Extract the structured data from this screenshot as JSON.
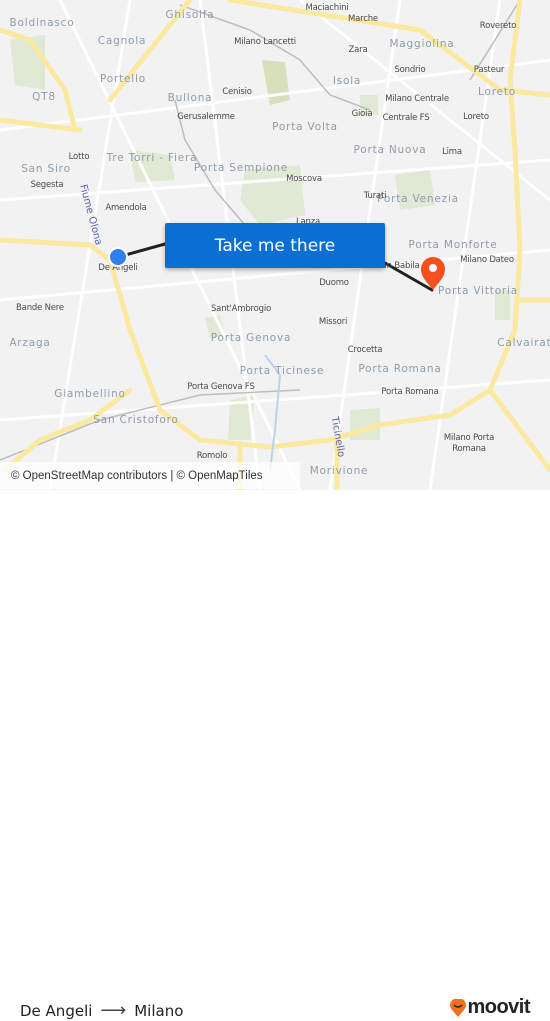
{
  "map": {
    "districts": [
      "Boldinasco",
      "Cagnola",
      "Ghisolfa",
      "Portello",
      "QT8",
      "Bullona",
      "Maggiolina",
      "Isola",
      "Porta Volta",
      "Porta Nuova",
      "Loreto",
      "Tre Torri - Fiera",
      "San Siro",
      "Porta Sempione",
      "Porta Venezia",
      "Porta Monforte",
      "Porta Vittoria",
      "Arzaga",
      "Porta Genova",
      "Calvairate",
      "Porta Ticinese",
      "Porta Romana",
      "Giambellino",
      "San Cristoforo",
      "Morivione"
    ],
    "stations": [
      "Maciachini",
      "Marche",
      "Milano Lancetti",
      "Zara",
      "Sondrio",
      "Rovereto",
      "Pasteur",
      "Cenisio",
      "Milano Centrale",
      "Gioia",
      "Centrale FS",
      "Loreto",
      "Gerusalemme",
      "Lima",
      "Lotto",
      "Segesta",
      "Moscova",
      "Turati",
      "Amendola",
      "Bande Nere",
      "Sant'Ambrogio",
      "Duomo",
      "Missori",
      "Crocetta",
      "Porta Genova FS",
      "Porta Romana",
      "Milano Dateo",
      "Milano Porta",
      "Romana",
      "Romolo",
      "De Angeli",
      "San Babila",
      "Lanza"
    ],
    "waterways": [
      "Fiume Olona",
      "Ticinello"
    ],
    "origin_color": "#2f7ff0",
    "destination_color": "#f4511e",
    "attribution": "© OpenStreetMap contributors | © OpenMapTiles"
  },
  "cta": {
    "label": "Take me there",
    "color": "#0a6fd3"
  },
  "footer": {
    "origin": "De Angeli",
    "arrow_icon": "arrow-right-icon",
    "destination": "Milano",
    "logo": "moovit",
    "logo_color": "#f46f22"
  }
}
